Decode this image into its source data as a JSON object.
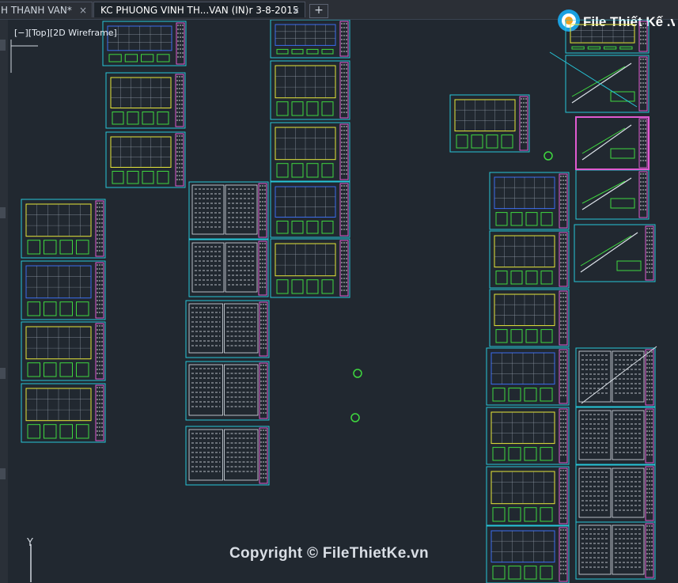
{
  "tabs": [
    {
      "label": "H THANH VAN*",
      "active": false
    },
    {
      "label": "KC PHUONG VINH TH...VAN (IN)r 3-8-2015",
      "active": true
    }
  ],
  "new_tab_label": "+",
  "close_glyph": "×",
  "viewport_label": "[−][Top][2D Wireframe]",
  "copyright": "Copyright © FileThietKe.vn",
  "logo_text": "File Thiết Kế .vn",
  "ucs_axis": "Y",
  "colors": {
    "canvas": "#212830",
    "frame": "#26c6d8",
    "accent_magenta": "#e05ad0",
    "accent_yellow": "#e8e838",
    "accent_green": "#3fd83f",
    "accent_blue": "#3a6cf0"
  }
}
